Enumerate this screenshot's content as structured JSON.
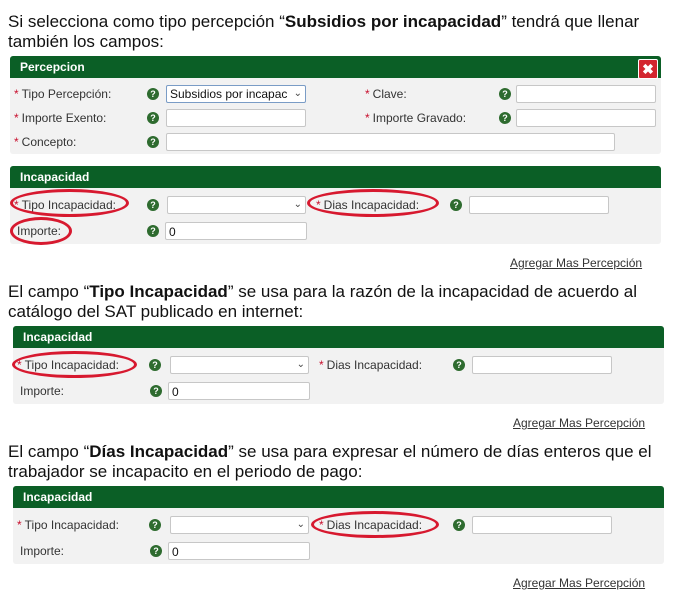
{
  "texts": {
    "intro": {
      "pre": "Si selecciona como tipo percepción “",
      "bold": "Subsidios por incapacidad",
      "post": "” tendrá que llenar también los campos:"
    },
    "tipo": {
      "pre": "El campo “",
      "bold": "Tipo Incapacidad",
      "post": "” se usa para la razón de la incapacidad de acuerdo al catálogo del SAT publicado en internet:"
    },
    "dias": {
      "pre": "El campo “",
      "bold": "Días Incapacidad",
      "post": "” se usa para expresar el número de días enteros que el trabajador se incapacito en el periodo de pago:"
    }
  },
  "percepcion": {
    "title": "Percepcion",
    "close_glyph": "✖",
    "tipo_label": "Tipo Percepción:",
    "tipo_value": "Subsidios por incapac",
    "clave_label": "Clave:",
    "exento_label": "Importe Exento:",
    "gravado_label": "Importe Gravado:",
    "concepto_label": "Concepto:"
  },
  "incapacidad": {
    "title": "Incapacidad",
    "tipo_label": "Tipo Incapacidad:",
    "dias_label": "Dias Incapacidad:",
    "importe_label": "Importe:",
    "importe_value": "0",
    "agregar_link": "Agregar Mas Percepción"
  },
  "required_mark": "*",
  "help_glyph": "?",
  "chevron_glyph": "⌄",
  "colors": {
    "header": "#0b5f26",
    "highlight": "#d7192f",
    "close": "#d3262f"
  }
}
